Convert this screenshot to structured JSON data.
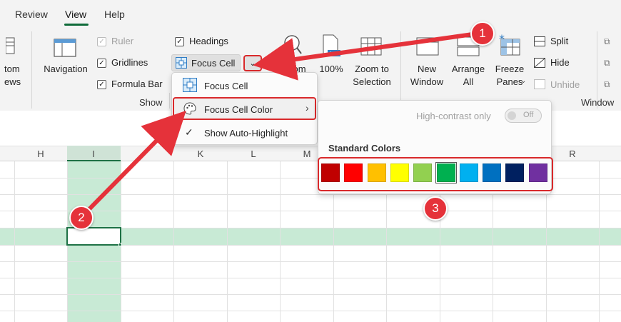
{
  "tabs": [
    {
      "label": "Review"
    },
    {
      "label": "View"
    },
    {
      "label": "Help"
    }
  ],
  "ribbon": {
    "partial_left_top": "tom",
    "partial_left_bottom": "ews",
    "navigation": "Navigation",
    "ruler": "Ruler",
    "gridlines": "Gridlines",
    "formula_bar": "Formula Bar",
    "headings": "Headings",
    "focus_cell": "Focus Cell",
    "show_group": "Show",
    "zoom": "Zoom",
    "zoom100": "100%",
    "zoom_to": "Zoom to",
    "selection": "Selection",
    "new": "New",
    "window": "Window",
    "arrange": "Arrange",
    "all": "All",
    "freeze": "Freeze",
    "panes": "Panes",
    "split": "Split",
    "hide": "Hide",
    "unhide": "Unhide",
    "window_group": "Window"
  },
  "focus_menu": {
    "items": [
      {
        "label": "Focus Cell"
      },
      {
        "label": "Focus Cell Color"
      },
      {
        "label": "Show Auto-Highlight"
      }
    ]
  },
  "color_panel": {
    "high_contrast": "High-contrast only",
    "toggle_state": "Off",
    "heading": "Standard Colors",
    "swatches": [
      {
        "color": "#c00000"
      },
      {
        "color": "#ff0000"
      },
      {
        "color": "#ffc000"
      },
      {
        "color": "#ffff00"
      },
      {
        "color": "#92d050"
      },
      {
        "color": "#00b050"
      },
      {
        "color": "#00b0f0"
      },
      {
        "color": "#0070c0"
      },
      {
        "color": "#002060"
      },
      {
        "color": "#7030a0"
      }
    ]
  },
  "columns": [
    "H",
    "I",
    "K",
    "L",
    "M",
    "R"
  ],
  "badges": [
    "1",
    "2",
    "3"
  ],
  "colors": {
    "accent_green": "#1e7145",
    "highlight": "#c8ead5",
    "callout_red": "#e5323a"
  }
}
